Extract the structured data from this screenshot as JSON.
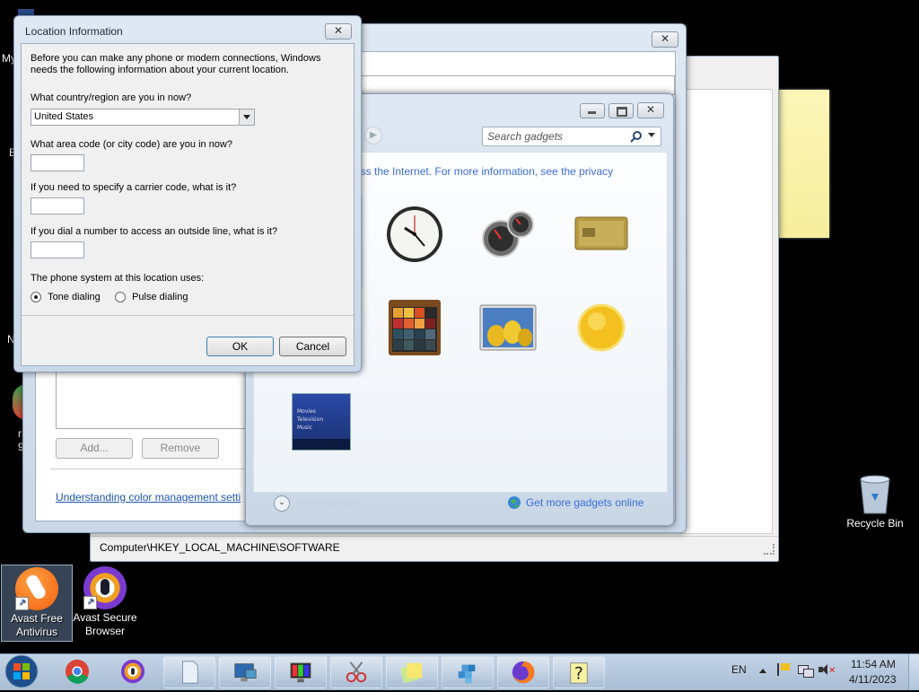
{
  "desktop": {
    "icons": [
      {
        "label_line1": "Avast Free",
        "label_line2": "Antivirus"
      },
      {
        "label_line1": "Avast Secure",
        "label_line2": "Browser"
      },
      {
        "label_line1": "Recycle Bin",
        "label_line2": ""
      }
    ],
    "partial_labels": [
      "My",
      "E",
      "N",
      "r",
      "9"
    ]
  },
  "location_dialog": {
    "title": "Location Information",
    "intro": "Before you can make any phone or modem connections, Windows needs the following information about your current location.",
    "country_label": "What country/region are you in now?",
    "country_value": "United States",
    "area_code_label": "What area code (or city code) are you in now?",
    "area_code_value": "",
    "carrier_label": "If you need to specify a carrier code, what is it?",
    "carrier_value": "",
    "outside_line_label": "If you dial a number to access an outside line, what is it?",
    "outside_line_value": "",
    "phone_system_label": "The phone system at this location uses:",
    "tone_label": "Tone dialing",
    "pulse_label": "Pulse dialing",
    "tone_selected": true,
    "ok_label": "OK",
    "cancel_label": "Cancel"
  },
  "color_mgmt": {
    "add_label": "Add...",
    "remove_label": "Remove",
    "link_text": "Understanding color management setti"
  },
  "gadgets": {
    "search_placeholder": "Search gadgets",
    "info_text": "ess the Internet.  For more information, see the privacy",
    "show_details": "Show details",
    "more_online": "Get more gadgets online",
    "items": [
      "clock-gadget",
      "cpu-meter-gadget",
      "currency-gadget",
      "picture-puzzle-gadget",
      "slide-show-gadget",
      "weather-gadget",
      "media-center-gadget"
    ],
    "media_lines": [
      "Movies",
      "Television",
      "Music"
    ]
  },
  "regedit": {
    "status_path": "Computer\\HKEY_LOCAL_MACHINE\\SOFTWARE"
  },
  "taskbar": {
    "language": "EN",
    "time": "11:54 AM",
    "date": "4/11/2023",
    "apps": [
      "chrome",
      "avast-secure-browser",
      "notepad",
      "remote-desktop",
      "display",
      "snipping-tool",
      "sticky-notes",
      "registry-editor",
      "firefox",
      "help"
    ]
  }
}
